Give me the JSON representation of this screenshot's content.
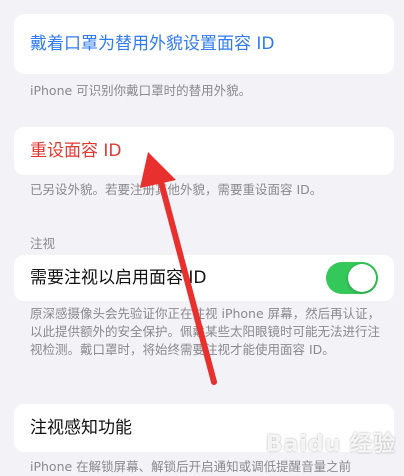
{
  "alt_appearance": {
    "label": "戴着口罩为替用外貌设置面容 ID",
    "footer": "iPhone 可识别你戴口罩时的替用外貌。"
  },
  "reset": {
    "label": "重设面容 ID",
    "footer": "已另设外貌。若要注册其他外貌，需要重设面容 ID。"
  },
  "attention": {
    "header": "注视",
    "require_label": "需要注视以启用面容 ID",
    "require_enabled": true,
    "footer": "原深感摄像头会先验证你正在注视 iPhone 屏幕，然后再认证，以此提供额外的安全保护。佩戴某些太阳眼镜时可能无法进行注视检测。戴口罩时，将始终需要注视才能使用面容 ID。"
  },
  "aware": {
    "label": "注视感知功能",
    "footer_partial": "iPhone 在解锁屏幕、解锁后开启通知或调低提醒音量之前"
  },
  "watermark": "Baidu 经验",
  "colors": {
    "accent_blue": "#2f7bf6",
    "destructive_red": "#e4372f",
    "toggle_green": "#34c759",
    "arrow_red": "#e8302e"
  }
}
